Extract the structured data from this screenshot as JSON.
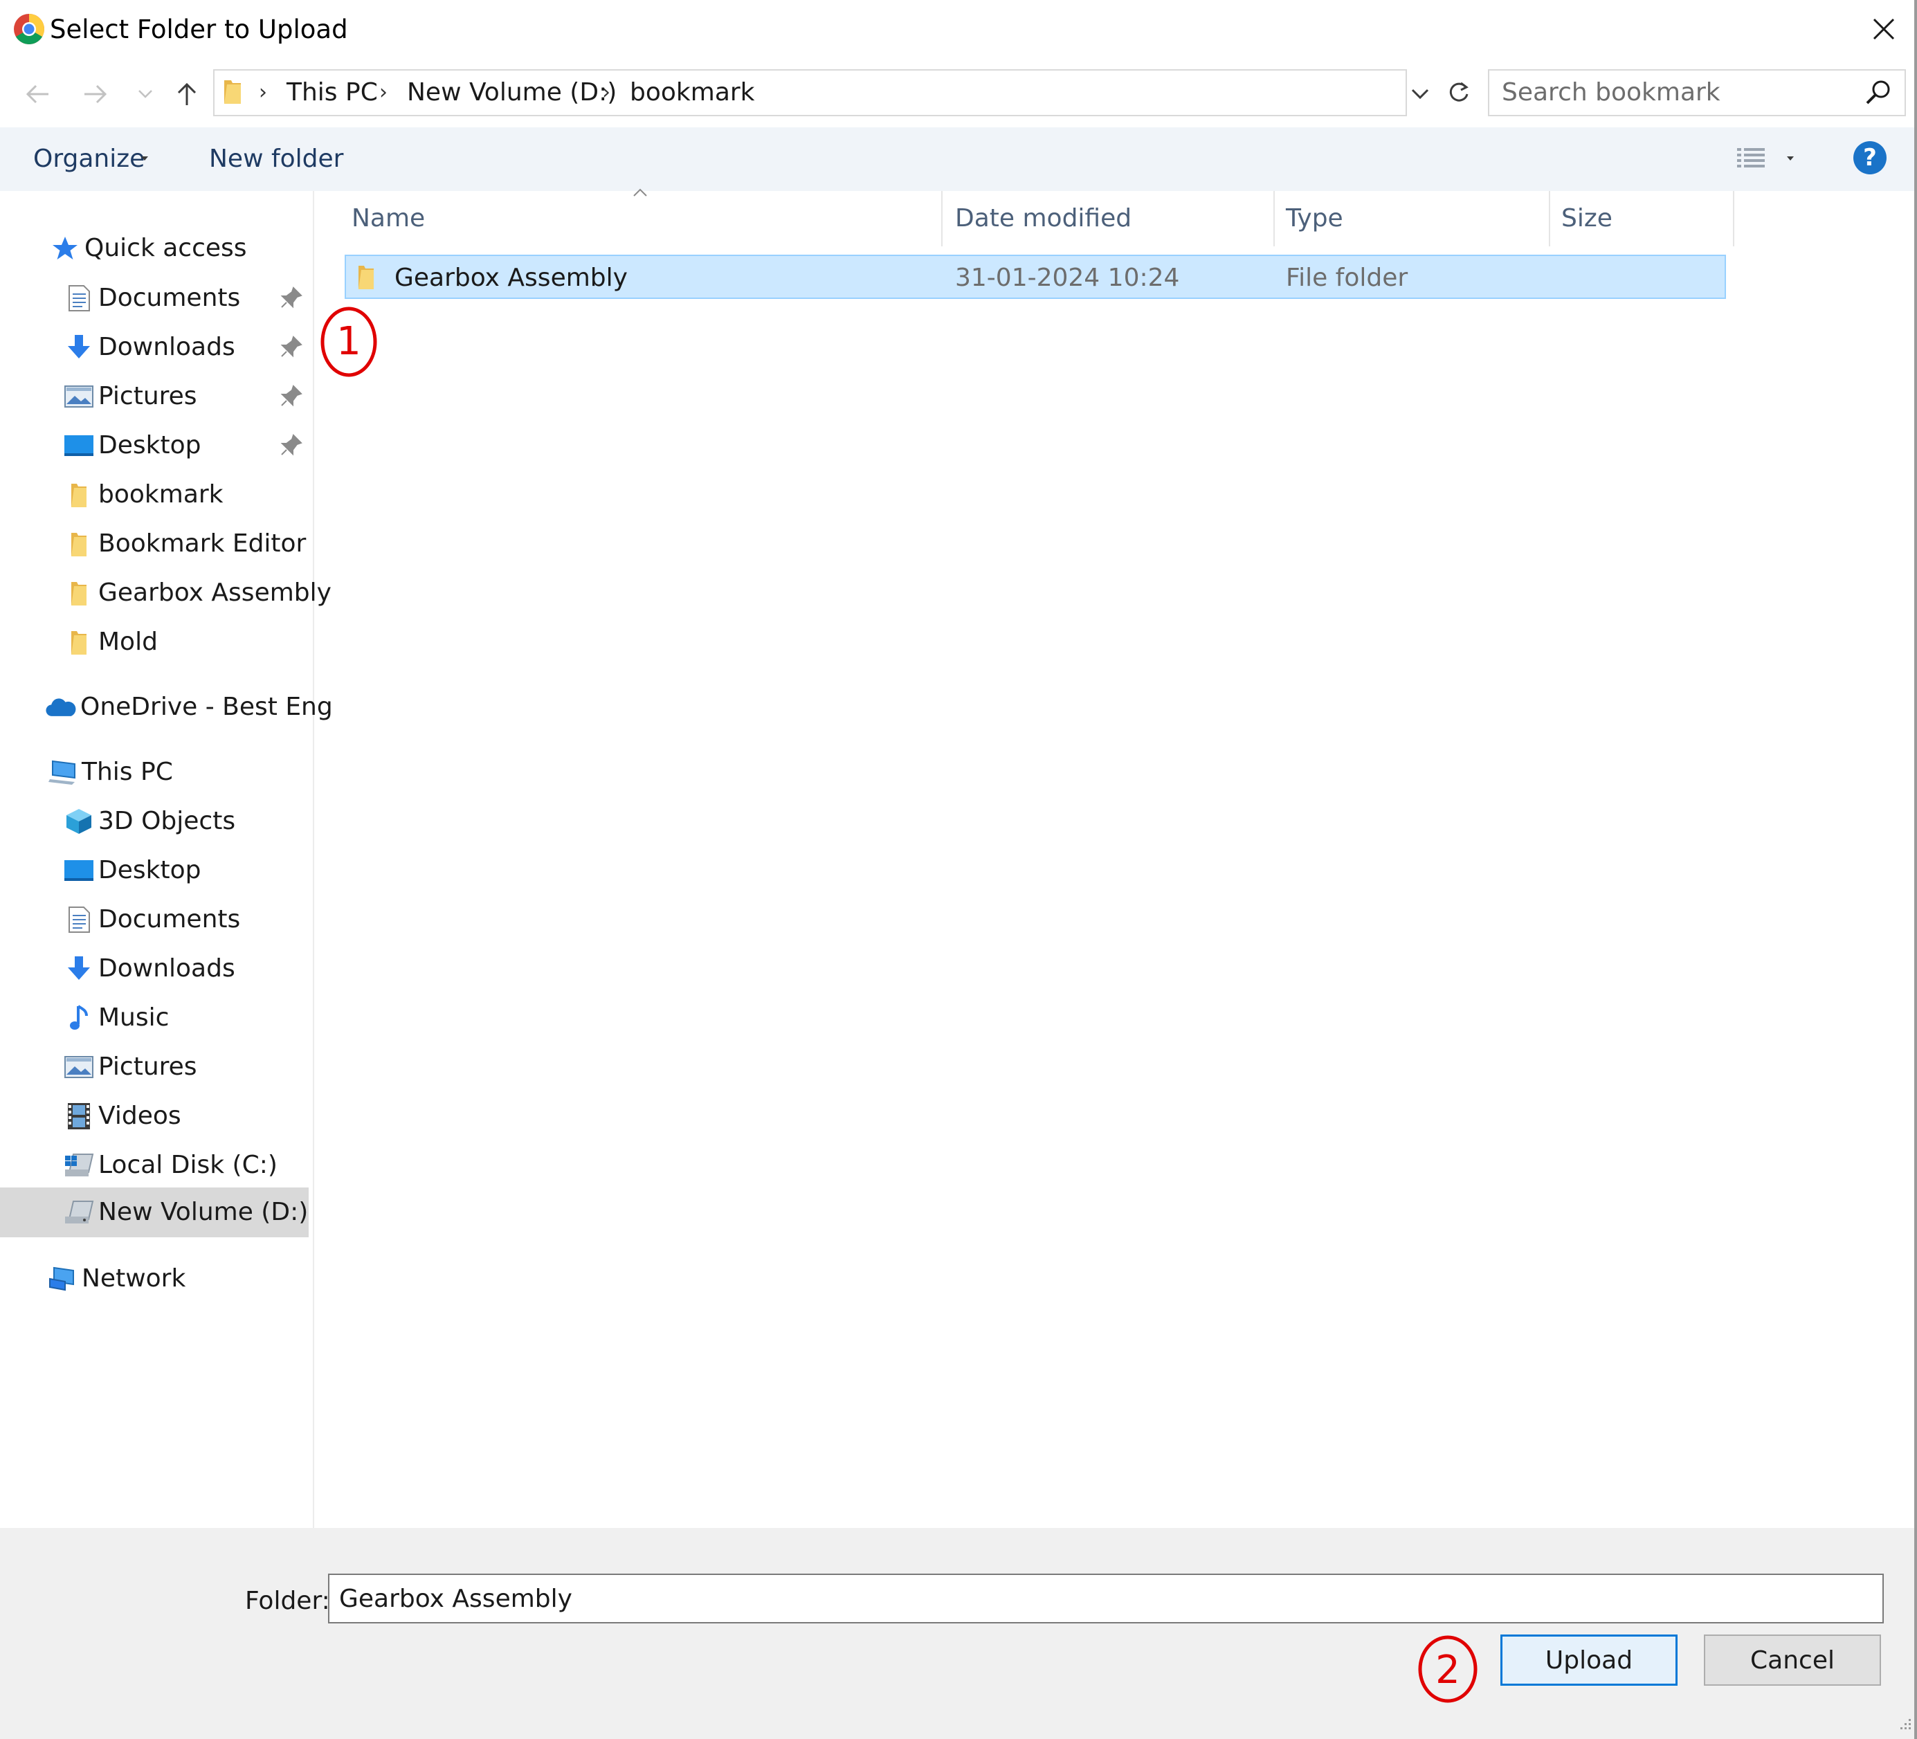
{
  "window": {
    "title": "Select Folder to Upload"
  },
  "address": {
    "crumbs": [
      "This PC",
      "New Volume (D:)",
      "bookmark"
    ]
  },
  "search": {
    "placeholder": "Search bookmark"
  },
  "toolbar": {
    "organize_label": "Organize",
    "new_folder_label": "New folder",
    "help_label": "?"
  },
  "sidebar": {
    "quick_access": {
      "label": "Quick access",
      "items": [
        {
          "label": "Documents",
          "icon": "documents-icon",
          "pinned": true
        },
        {
          "label": "Downloads",
          "icon": "downloads-icon",
          "pinned": true
        },
        {
          "label": "Pictures",
          "icon": "pictures-icon",
          "pinned": true
        },
        {
          "label": "Desktop",
          "icon": "desktop-icon",
          "pinned": true
        },
        {
          "label": "bookmark",
          "icon": "folder-icon",
          "pinned": false
        },
        {
          "label": "Bookmark Editor",
          "icon": "folder-icon",
          "pinned": false
        },
        {
          "label": "Gearbox Assembly",
          "icon": "folder-icon",
          "pinned": false
        },
        {
          "label": "Mold",
          "icon": "folder-icon",
          "pinned": false
        }
      ]
    },
    "onedrive": {
      "label": "OneDrive - Best Eng"
    },
    "this_pc": {
      "label": "This PC",
      "items": [
        {
          "label": "3D Objects",
          "icon": "3d-objects-icon"
        },
        {
          "label": "Desktop",
          "icon": "desktop-icon"
        },
        {
          "label": "Documents",
          "icon": "documents-icon"
        },
        {
          "label": "Downloads",
          "icon": "downloads-icon"
        },
        {
          "label": "Music",
          "icon": "music-icon"
        },
        {
          "label": "Pictures",
          "icon": "pictures-icon"
        },
        {
          "label": "Videos",
          "icon": "videos-icon"
        },
        {
          "label": "Local Disk (C:)",
          "icon": "local-disk-icon"
        },
        {
          "label": "New Volume (D:)",
          "icon": "drive-icon",
          "selected": true
        }
      ]
    },
    "network": {
      "label": "Network"
    }
  },
  "file_list": {
    "columns": [
      "Name",
      "Date modified",
      "Type",
      "Size"
    ],
    "rows": [
      {
        "name": "Gearbox Assembly",
        "date_modified": "31-01-2024 10:24",
        "type": "File folder",
        "size": "",
        "selected": true
      }
    ]
  },
  "footer": {
    "folder_label": "Folder:",
    "folder_value": "Gearbox Assembly",
    "upload_label": "Upload",
    "cancel_label": "Cancel"
  },
  "annotations": {
    "marker_1": "1",
    "marker_2": "2"
  },
  "colors": {
    "accent": "#0078d7",
    "selection": "#cce8ff",
    "annotation": "#e00000",
    "folder": "#f8d775"
  }
}
